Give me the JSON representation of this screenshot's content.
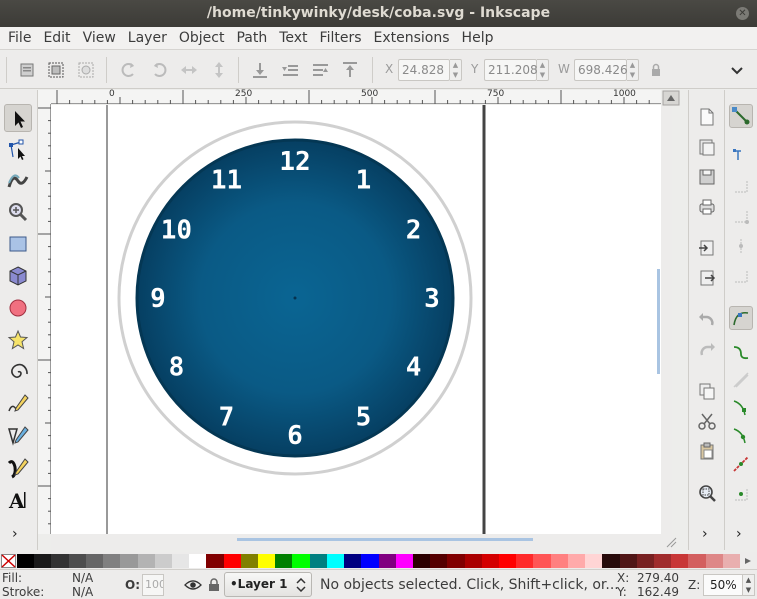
{
  "window": {
    "title": "/home/tinkywinky/desk/coba.svg - Inkscape"
  },
  "menu": [
    "File",
    "Edit",
    "View",
    "Layer",
    "Object",
    "Path",
    "Text",
    "Filters",
    "Extensions",
    "Help"
  ],
  "toolbar": {
    "x_label": "X",
    "x_value": "24.828",
    "y_label": "Y",
    "y_value": "211.208",
    "w_label": "W",
    "w_value": "698.426"
  },
  "ruler": {
    "h_labels": [
      "0",
      "250",
      "500",
      "750",
      "1000"
    ],
    "v_labels": [
      "7,5",
      "0",
      "5",
      "5",
      "0",
      "5",
      "0",
      "5"
    ]
  },
  "clock": {
    "numbers": [
      "12",
      "1",
      "2",
      "3",
      "4",
      "5",
      "6",
      "7",
      "8",
      "9",
      "10",
      "11"
    ],
    "face_color": "#0a6593",
    "face_edge": "#043754",
    "ring_color": "#d0d0d0"
  },
  "palette": {
    "colors": [
      "#000000",
      "#1a1a1a",
      "#333333",
      "#4d4d4d",
      "#666666",
      "#808080",
      "#999999",
      "#b3b3b3",
      "#cccccc",
      "#e6e6e6",
      "#ffffff",
      "#800000",
      "#ff0000",
      "#808000",
      "#ffff00",
      "#008000",
      "#00ff00",
      "#008080",
      "#00ffff",
      "#000080",
      "#0000ff",
      "#800080",
      "#ff00ff",
      "#2b0000",
      "#550000",
      "#800000",
      "#aa0000",
      "#d40000",
      "#ff0000",
      "#ff2a2a",
      "#ff5555",
      "#ff8080",
      "#ffaaaa",
      "#ffd5d5",
      "#280b0b",
      "#501616",
      "#782121",
      "#a02c2c",
      "#c83737",
      "#d35f5f",
      "#de8787",
      "#e9afaf"
    ]
  },
  "status": {
    "fill_label": "Fill:",
    "fill_value": "N/A",
    "stroke_label": "Stroke:",
    "stroke_value": "N/A",
    "opacity_label": "O:",
    "opacity_value": "100",
    "layer": "•Layer 1",
    "message": "No objects selected. Click, Shift+click, or...",
    "x_label": "X:",
    "x_value": "279.40",
    "y_label": "Y:",
    "y_value": "162.49",
    "zoom_label": "Z:",
    "zoom_value": "50%"
  }
}
